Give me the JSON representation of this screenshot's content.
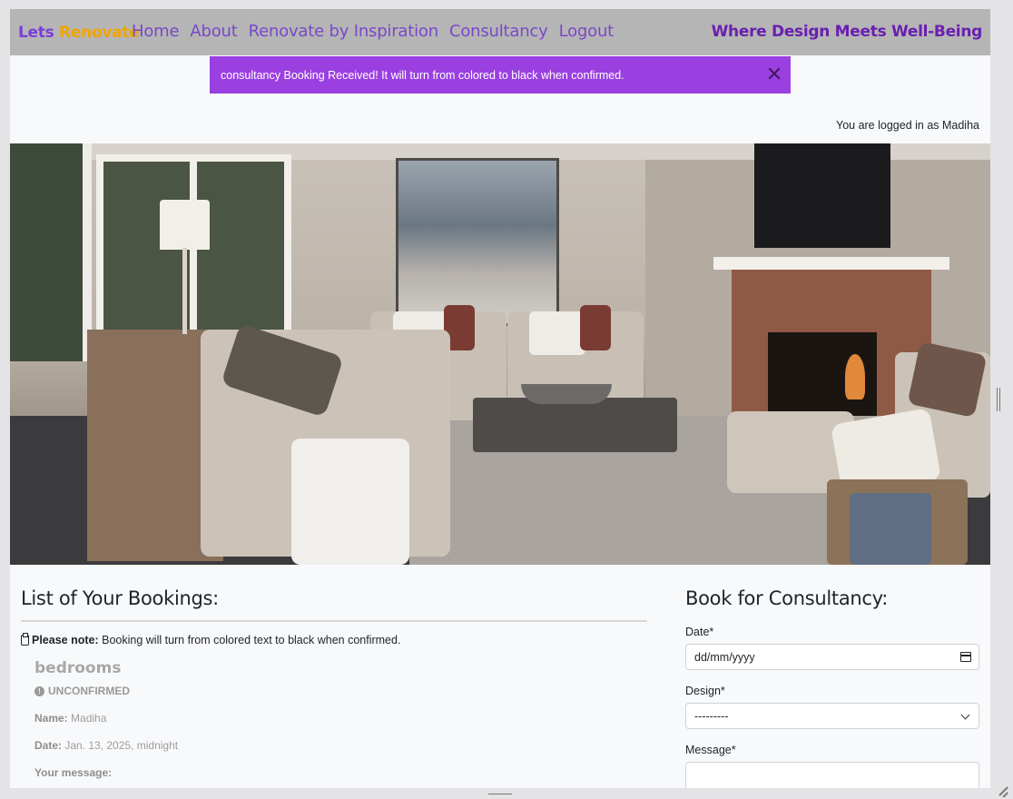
{
  "brand": {
    "part1": "Lets",
    "part2": "Renovate"
  },
  "nav": {
    "items": [
      "Home",
      "About",
      "Renovate by Inspiration",
      "Consultancy",
      "Logout"
    ]
  },
  "tagline": "Where Design Meets Well-Being",
  "alert": {
    "message": "consultancy Booking Received! It will turn from colored to black when confirmed."
  },
  "user": {
    "logged_in_text": "You are logged in as Madiha"
  },
  "bookings": {
    "title": "List of Your Bookings:",
    "note_label": "Please note:",
    "note_text": " Booking will turn from colored text to black when confirmed.",
    "items": [
      {
        "type": "bedrooms",
        "status": "UNCONFIRMED",
        "name_label": "Name:",
        "name": " Madiha",
        "date_label": "Date:",
        "date": " Jan. 13, 2025, midnight",
        "message_label": "Your message:"
      }
    ]
  },
  "form": {
    "title": "Book for Consultancy:",
    "date_label": "Date*",
    "date_placeholder": "dd/mm/yyyy",
    "design_label": "Design*",
    "design_value": "---------",
    "message_label": "Message*"
  },
  "colors": {
    "accent": "#7a3fd6",
    "brand_secondary": "#f0a500",
    "alert_bg": "#9a3fe0",
    "navbar_bg": "#b5b5b5"
  }
}
